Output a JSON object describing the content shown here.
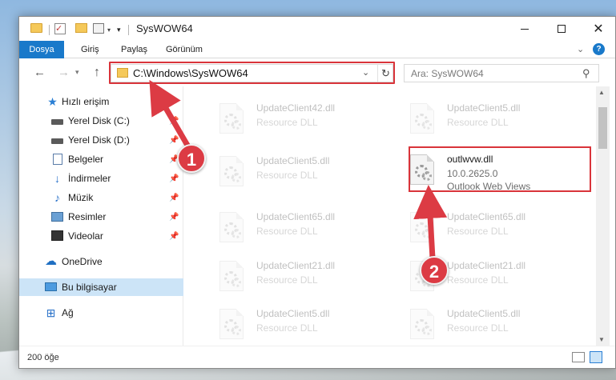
{
  "window": {
    "title": "SysWOW64",
    "minimize_glyph": "",
    "close_glyph": "✕"
  },
  "ribbon": {
    "tabs": [
      {
        "label": "Dosya"
      },
      {
        "label": "Giriş"
      },
      {
        "label": "Paylaş"
      },
      {
        "label": "Görünüm"
      }
    ],
    "help": "?"
  },
  "navigation": {
    "address": "C:\\Windows\\SysWOW64",
    "search_placeholder": "Ara: SysWOW64"
  },
  "sidebar": {
    "items": [
      {
        "label": "Hızlı erişim",
        "icon": "star-icon"
      },
      {
        "label": "Yerel Disk (C:)",
        "icon": "drive-icon",
        "pinned": true
      },
      {
        "label": "Yerel Disk (D:)",
        "icon": "drive-icon",
        "pinned": true
      },
      {
        "label": "Belgeler",
        "icon": "document-icon",
        "pinned": true
      },
      {
        "label": "İndirmeler",
        "icon": "download-icon",
        "pinned": true
      },
      {
        "label": "Müzik",
        "icon": "music-icon",
        "pinned": true
      },
      {
        "label": "Resimler",
        "icon": "pictures-icon",
        "pinned": true
      },
      {
        "label": "Videolar",
        "icon": "video-icon",
        "pinned": true
      },
      {
        "label": "OneDrive",
        "icon": "cloud-icon"
      },
      {
        "label": "Bu bilgisayar",
        "icon": "computer-icon",
        "selected": true
      },
      {
        "label": "Ağ",
        "icon": "network-icon"
      }
    ]
  },
  "files": {
    "left_column": [
      {
        "name": "UpdateClient42.dll",
        "desc": "Resource DLL"
      },
      {
        "name": "UpdateClient5.dll",
        "desc": "Resource DLL"
      },
      {
        "name": "UpdateClient65.dll",
        "desc": "Resource DLL"
      },
      {
        "name": "UpdateClient21.dll",
        "desc": "Resource DLL"
      },
      {
        "name": "UpdateClient5.dll",
        "desc": "Resource DLL"
      }
    ],
    "right_column": [
      {
        "name": "UpdateClient5.dll",
        "desc": "Resource DLL"
      },
      {
        "name": "UpdateClient65.dll",
        "desc": "Resource DLL"
      },
      {
        "name": "UpdateClient21.dll",
        "desc": "Resource DLL"
      },
      {
        "name": "UpdateClient5.dll",
        "desc": "Resource DLL"
      }
    ],
    "highlighted": {
      "name": "outlwvw.dll",
      "version": "10.0.2625.0",
      "description": "Outlook Web Views"
    }
  },
  "status": {
    "item_count": "200 öğe"
  },
  "annotations": {
    "step1": "1",
    "step2": "2",
    "color": "#dc3b44"
  }
}
